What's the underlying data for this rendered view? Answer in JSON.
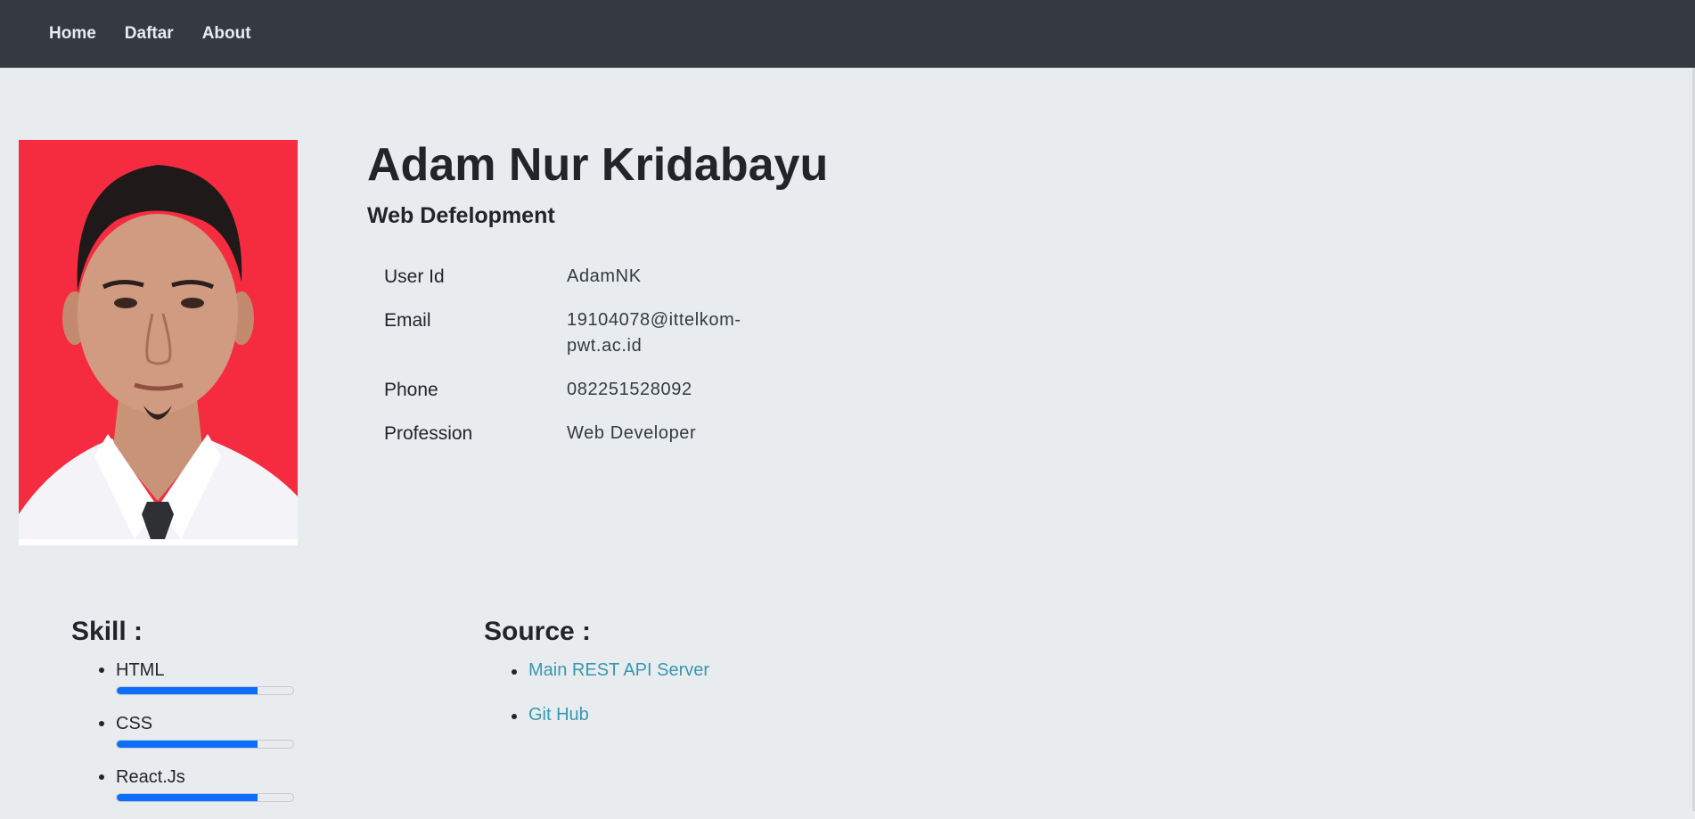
{
  "navbar": {
    "items": [
      {
        "label": "Home"
      },
      {
        "label": "Daftar"
      },
      {
        "label": "About"
      }
    ]
  },
  "profile": {
    "name": "Adam Nur Kridabayu",
    "subtitle": "Web Defelopment",
    "info": [
      {
        "label": "User Id",
        "value": "AdamNK"
      },
      {
        "label": "Email",
        "value": "19104078@ittelkom-pwt.ac.id"
      },
      {
        "label": "Phone",
        "value": "082251528092"
      },
      {
        "label": "Profession",
        "value": "Web Developer"
      }
    ]
  },
  "skills": {
    "title": "Skill :",
    "items": [
      {
        "label": "HTML",
        "level": 0.8
      },
      {
        "label": "CSS",
        "level": 0.8
      },
      {
        "label": "React.Js",
        "level": 0.8
      }
    ]
  },
  "sources": {
    "title": "Source :",
    "items": [
      {
        "label": "Main REST API Server"
      },
      {
        "label": "Git Hub"
      }
    ]
  },
  "colors": {
    "navbar_bg": "#343a40",
    "page_bg": "#e9ecef",
    "progress": "#0d6efd",
    "link": "#3798b0",
    "photo_bg": "#f52c3f"
  }
}
